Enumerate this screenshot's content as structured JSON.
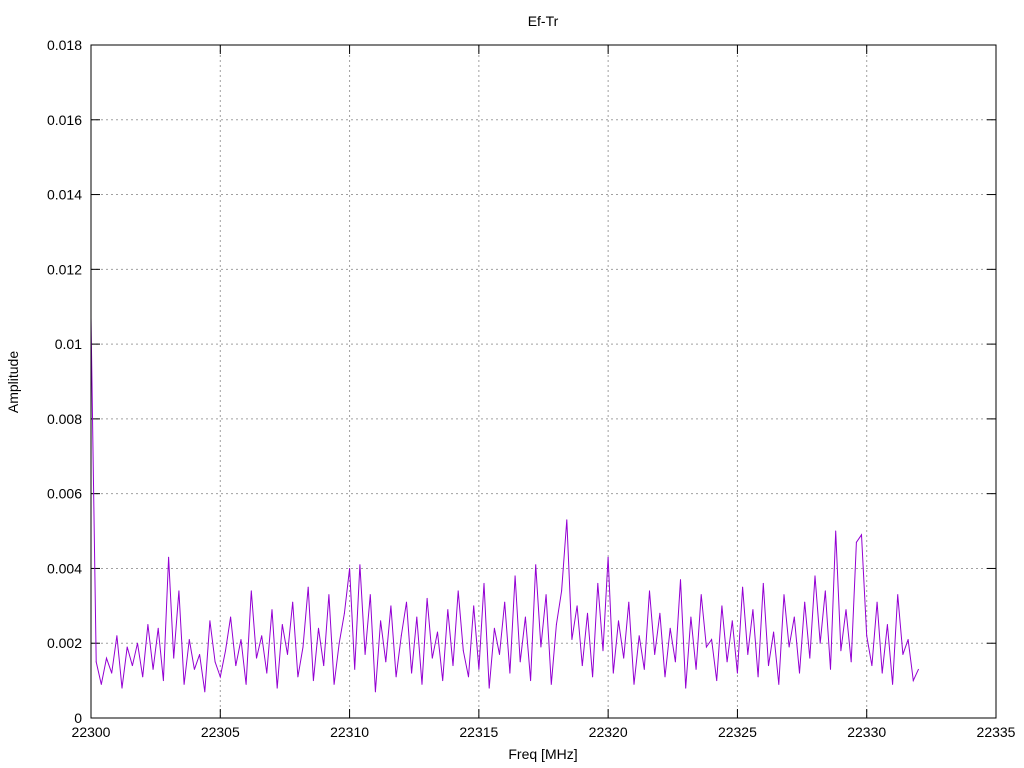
{
  "chart_data": {
    "type": "line",
    "title": "Ef-Tr",
    "xlabel": "Freq [MHz]",
    "ylabel": "Amplitude",
    "xlim": [
      22300,
      22335
    ],
    "ylim": [
      0,
      0.018
    ],
    "x_ticks": [
      22300,
      22305,
      22310,
      22315,
      22320,
      22325,
      22330,
      22335
    ],
    "x_tick_labels": [
      "22300",
      "22305",
      "22310",
      "22315",
      "22320",
      "22325",
      "22330",
      "22335"
    ],
    "y_ticks": [
      0,
      0.002,
      0.004,
      0.006,
      0.008,
      0.01,
      0.012,
      0.014,
      0.016,
      0.018
    ],
    "y_tick_labels": [
      "0",
      "0.002",
      "0.004",
      "0.006",
      "0.008",
      "0.01",
      "0.012",
      "0.014",
      "0.016",
      "0.018"
    ],
    "grid": true,
    "legend": "none",
    "series": [
      {
        "name": "Ef-Tr",
        "color": "#9400d3",
        "x_start": 22300,
        "x_step": 0.2,
        "values": [
          0.0107,
          0.0015,
          0.0009,
          0.0016,
          0.0012,
          0.0022,
          0.0008,
          0.0019,
          0.0014,
          0.002,
          0.0011,
          0.0025,
          0.0013,
          0.0024,
          0.001,
          0.0043,
          0.0016,
          0.0034,
          0.0009,
          0.0021,
          0.0013,
          0.0017,
          0.0007,
          0.0026,
          0.0015,
          0.0011,
          0.0018,
          0.0027,
          0.0014,
          0.0021,
          0.0009,
          0.0034,
          0.0016,
          0.0022,
          0.0012,
          0.0029,
          0.0008,
          0.0025,
          0.0017,
          0.0031,
          0.0011,
          0.0019,
          0.0035,
          0.001,
          0.0024,
          0.0014,
          0.0033,
          0.0009,
          0.002,
          0.0028,
          0.004,
          0.0013,
          0.0041,
          0.0017,
          0.0033,
          0.0007,
          0.0026,
          0.0015,
          0.003,
          0.0011,
          0.0022,
          0.0031,
          0.0012,
          0.0027,
          0.0009,
          0.0032,
          0.0016,
          0.0023,
          0.001,
          0.0029,
          0.0014,
          0.0034,
          0.0018,
          0.0011,
          0.003,
          0.0013,
          0.0036,
          0.0008,
          0.0024,
          0.0017,
          0.0031,
          0.0012,
          0.0038,
          0.0015,
          0.0027,
          0.001,
          0.0041,
          0.0019,
          0.0033,
          0.0009,
          0.0025,
          0.0034,
          0.0053,
          0.0021,
          0.003,
          0.0014,
          0.0028,
          0.0011,
          0.0036,
          0.0018,
          0.0043,
          0.0012,
          0.0026,
          0.0016,
          0.0031,
          0.0009,
          0.0022,
          0.0013,
          0.0034,
          0.0017,
          0.0028,
          0.0011,
          0.0024,
          0.0015,
          0.0037,
          0.0008,
          0.0027,
          0.0013,
          0.0033,
          0.0019,
          0.0021,
          0.001,
          0.003,
          0.0015,
          0.0026,
          0.0012,
          0.0035,
          0.0017,
          0.0029,
          0.0011,
          0.0036,
          0.0014,
          0.0023,
          0.0009,
          0.0033,
          0.0019,
          0.0027,
          0.0012,
          0.0031,
          0.0016,
          0.0038,
          0.002,
          0.0034,
          0.0013,
          0.005,
          0.0018,
          0.0029,
          0.0015,
          0.0047,
          0.0049,
          0.0022,
          0.0014,
          0.0031,
          0.0012,
          0.0025,
          0.0009,
          0.0033,
          0.0017,
          0.0021,
          0.001,
          0.0013
        ]
      }
    ]
  }
}
